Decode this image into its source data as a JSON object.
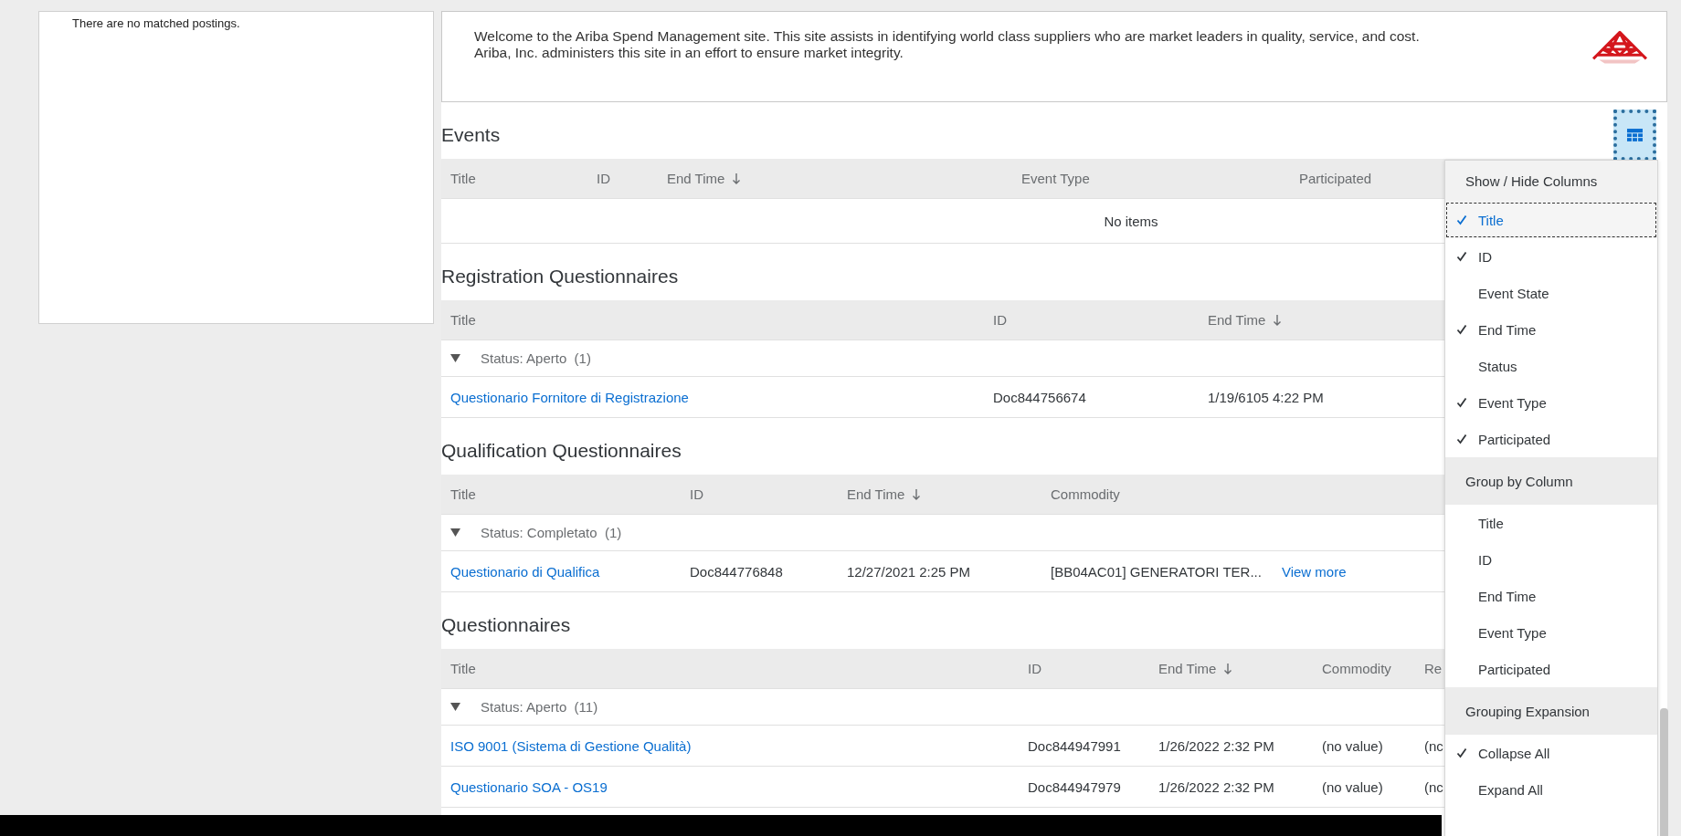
{
  "postings": {
    "message": "There are no matched postings."
  },
  "welcome": {
    "parts": [
      "Welcome to the ",
      "Ariba Spend Management",
      " site.  This site assists in identifying world class suppliers who are market leaders in quality, service, and cost.",
      "Ariba, Inc. administers this site in an effort to ensure market integrity."
    ]
  },
  "sections": [
    {
      "title": "Events",
      "columns": [
        {
          "label": "Title",
          "sorted": false
        },
        {
          "label": "ID",
          "sorted": false
        },
        {
          "label": "End Time",
          "sorted": true
        },
        {
          "label": "Event Type",
          "sorted": false
        },
        {
          "label": "Participated",
          "sorted": false
        }
      ],
      "empty": "No items"
    },
    {
      "title": "Registration Questionnaires",
      "columns": [
        {
          "label": "Title",
          "sorted": false
        },
        {
          "label": "ID",
          "sorted": false
        },
        {
          "label": "End Time",
          "sorted": true
        }
      ],
      "groups": [
        {
          "label": "Status: Aperto",
          "count": "(1)",
          "expanded": true,
          "rows": [
            {
              "cells": [
                "Questionario Fornitore di Registrazione",
                "Doc844756674",
                "1/19/6105 4:22 PM"
              ]
            }
          ]
        }
      ]
    },
    {
      "title": "Qualification Questionnaires",
      "columns": [
        {
          "label": "Title",
          "sorted": false
        },
        {
          "label": "ID",
          "sorted": false
        },
        {
          "label": "End Time",
          "sorted": true
        },
        {
          "label": "Commodity",
          "sorted": false
        }
      ],
      "groups": [
        {
          "label": "Status: Completato",
          "count": "(1)",
          "expanded": true,
          "rows": [
            {
              "cells": [
                "Questionario di Qualifica",
                "Doc844776848",
                "12/27/2021 2:25 PM",
                "[BB04AC01] GENERATORI TER..."
              ],
              "link": "View more"
            }
          ]
        }
      ]
    },
    {
      "title": "Questionnaires",
      "columns": [
        {
          "label": "Title",
          "sorted": false
        },
        {
          "label": "ID",
          "sorted": false
        },
        {
          "label": "End Time",
          "sorted": true
        },
        {
          "label": "Commodity",
          "sorted": false
        },
        {
          "label": "Re",
          "sorted": false
        }
      ],
      "groups": [
        {
          "label": "Status: Aperto",
          "count": "(11)",
          "expanded": true,
          "rows": [
            {
              "cells": [
                "ISO 9001 (Sistema di Gestione Qualità)",
                "Doc844947991",
                "1/26/2022 2:32 PM",
                "(no value)",
                "(nc"
              ]
            },
            {
              "cells": [
                "Questionario SOA - OS19",
                "Doc844947979",
                "1/26/2022 2:32 PM",
                "(no value)",
                "(nc"
              ]
            }
          ]
        }
      ]
    }
  ],
  "column_menu": {
    "items": [
      {
        "kind": "header",
        "label": "Show / Hide Columns"
      },
      {
        "kind": "option",
        "label": "Title",
        "checked": true,
        "selected": true
      },
      {
        "kind": "option",
        "label": "ID",
        "checked": true,
        "selected": false
      },
      {
        "kind": "option",
        "label": "Event State",
        "checked": false,
        "selected": false
      },
      {
        "kind": "option",
        "label": "End Time",
        "checked": true,
        "selected": false
      },
      {
        "kind": "option",
        "label": "Status",
        "checked": false,
        "selected": false
      },
      {
        "kind": "option",
        "label": "Event Type",
        "checked": true,
        "selected": false
      },
      {
        "kind": "option",
        "label": "Participated",
        "checked": true,
        "selected": false
      },
      {
        "kind": "header",
        "label": "Group by Column"
      },
      {
        "kind": "option",
        "label": "Title",
        "checked": false,
        "selected": false
      },
      {
        "kind": "option",
        "label": "ID",
        "checked": false,
        "selected": false
      },
      {
        "kind": "option",
        "label": "End Time",
        "checked": false,
        "selected": false
      },
      {
        "kind": "option",
        "label": "Event Type",
        "checked": false,
        "selected": false
      },
      {
        "kind": "option",
        "label": "Participated",
        "checked": false,
        "selected": false
      },
      {
        "kind": "header",
        "label": "Grouping Expansion"
      },
      {
        "kind": "option",
        "label": "Collapse All",
        "checked": true,
        "selected": false
      },
      {
        "kind": "option",
        "label": "Expand All",
        "checked": false,
        "selected": false
      }
    ]
  }
}
